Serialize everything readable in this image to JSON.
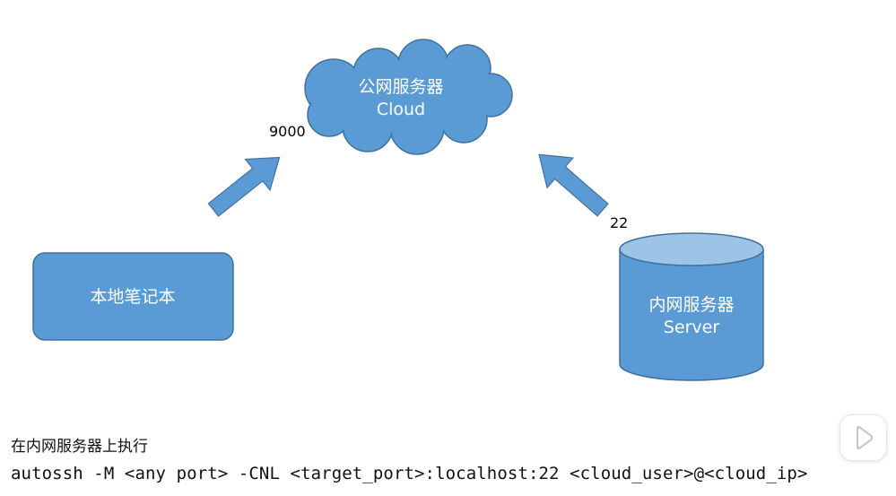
{
  "diagram": {
    "cloud": {
      "label_line1": "公网服务器",
      "label_line2": "Cloud",
      "color": "#5b9bd5"
    },
    "laptop": {
      "label": "本地笔记本",
      "color": "#5b9bd5"
    },
    "server": {
      "label_line1": "内网服务器",
      "label_line2": "Server",
      "body_color": "#5b9bd5",
      "top_color": "#9dc3e6"
    },
    "ports": {
      "cloud_port": "9000",
      "server_port": "22"
    },
    "arrow_color": "#5b9bd5"
  },
  "caption": "在内网服务器上执行",
  "command": "autossh -M <any port> -CNL <target_port>:localhost:22 <cloud_user>@<cloud_ip>",
  "player": {
    "icon": "play-icon"
  }
}
